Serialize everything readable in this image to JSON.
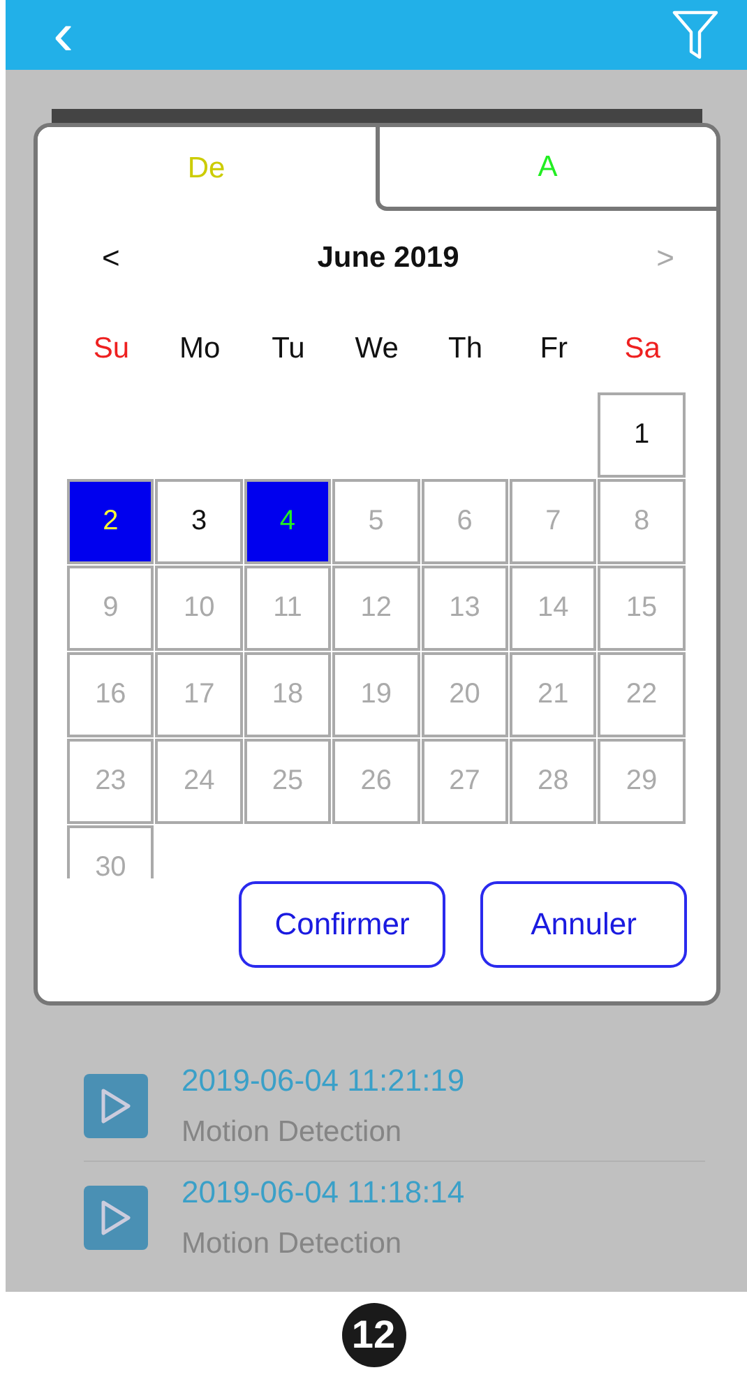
{
  "header": {
    "back": "‹"
  },
  "dialog": {
    "tabs": [
      {
        "label": "De",
        "selected": true,
        "color": "#cccc00"
      },
      {
        "label": "A",
        "selected": false,
        "color": "#22ee22"
      }
    ],
    "month": {
      "prev": "<",
      "prev_disabled": false,
      "title": "June 2019",
      "next": ">",
      "next_disabled": true
    },
    "weekdays": [
      {
        "label": "Su",
        "weekend": true
      },
      {
        "label": "Mo",
        "weekend": false
      },
      {
        "label": "Tu",
        "weekend": false
      },
      {
        "label": "We",
        "weekend": false
      },
      {
        "label": "Th",
        "weekend": false
      },
      {
        "label": "Fr",
        "weekend": false
      },
      {
        "label": "Sa",
        "weekend": true
      }
    ],
    "weeks": [
      [
        {
          "kind": "blank"
        },
        {
          "kind": "blank"
        },
        {
          "kind": "blank"
        },
        {
          "kind": "blank"
        },
        {
          "kind": "blank"
        },
        {
          "kind": "blank"
        },
        {
          "kind": "day",
          "label": "1",
          "selected": false,
          "disabled": false
        }
      ],
      [
        {
          "kind": "start",
          "label": "2",
          "selected": true,
          "disabled": false
        },
        {
          "kind": "day",
          "label": "3",
          "selected": false,
          "disabled": false
        },
        {
          "kind": "end",
          "label": "4",
          "selected": true,
          "disabled": false
        },
        {
          "kind": "day",
          "label": "5",
          "selected": false,
          "disabled": true
        },
        {
          "kind": "day",
          "label": "6",
          "selected": false,
          "disabled": true
        },
        {
          "kind": "day",
          "label": "7",
          "selected": false,
          "disabled": true
        },
        {
          "kind": "day",
          "label": "8",
          "selected": false,
          "disabled": true
        }
      ],
      [
        {
          "kind": "day",
          "label": "9",
          "selected": false,
          "disabled": true
        },
        {
          "kind": "day",
          "label": "10",
          "selected": false,
          "disabled": true
        },
        {
          "kind": "day",
          "label": "11",
          "selected": false,
          "disabled": true
        },
        {
          "kind": "day",
          "label": "12",
          "selected": false,
          "disabled": true
        },
        {
          "kind": "day",
          "label": "13",
          "selected": false,
          "disabled": true
        },
        {
          "kind": "day",
          "label": "14",
          "selected": false,
          "disabled": true
        },
        {
          "kind": "day",
          "label": "15",
          "selected": false,
          "disabled": true
        }
      ],
      [
        {
          "kind": "day",
          "label": "16",
          "selected": false,
          "disabled": true
        },
        {
          "kind": "day",
          "label": "17",
          "selected": false,
          "disabled": true
        },
        {
          "kind": "day",
          "label": "18",
          "selected": false,
          "disabled": true
        },
        {
          "kind": "day",
          "label": "19",
          "selected": false,
          "disabled": true
        },
        {
          "kind": "day",
          "label": "20",
          "selected": false,
          "disabled": true
        },
        {
          "kind": "day",
          "label": "21",
          "selected": false,
          "disabled": true
        },
        {
          "kind": "day",
          "label": "22",
          "selected": false,
          "disabled": true
        }
      ],
      [
        {
          "kind": "day",
          "label": "23",
          "selected": false,
          "disabled": true
        },
        {
          "kind": "day",
          "label": "24",
          "selected": false,
          "disabled": true
        },
        {
          "kind": "day",
          "label": "25",
          "selected": false,
          "disabled": true
        },
        {
          "kind": "day",
          "label": "26",
          "selected": false,
          "disabled": true
        },
        {
          "kind": "day",
          "label": "27",
          "selected": false,
          "disabled": true
        },
        {
          "kind": "day",
          "label": "28",
          "selected": false,
          "disabled": true
        },
        {
          "kind": "day",
          "label": "29",
          "selected": false,
          "disabled": true
        }
      ],
      [
        {
          "kind": "day",
          "label": "30",
          "selected": false,
          "disabled": true
        }
      ]
    ],
    "buttons": [
      "Confirmer",
      "Annuler"
    ]
  },
  "events": [
    {
      "time": "2019-06-04 11:21:19",
      "label": "Motion Detection"
    },
    {
      "time": "2019-06-04 11:18:14",
      "label": "Motion Detection"
    }
  ],
  "page_badge": "12"
}
